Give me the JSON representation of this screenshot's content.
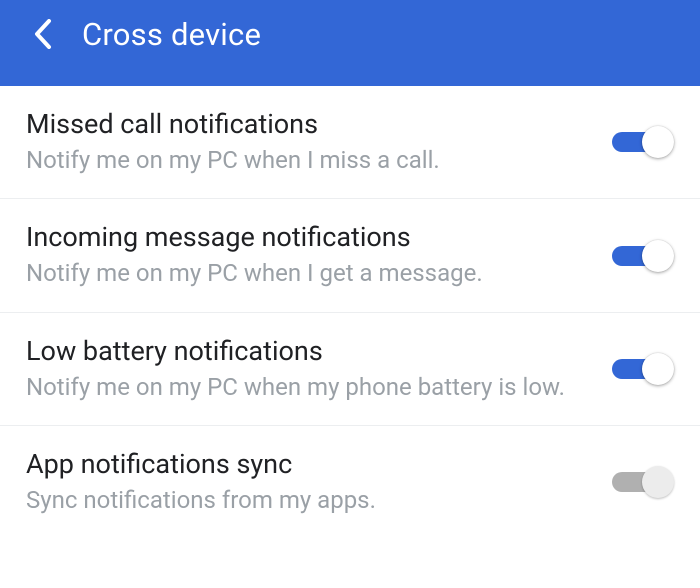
{
  "header": {
    "title": "Cross device"
  },
  "settings": [
    {
      "id": "missed-call",
      "title": "Missed call notifications",
      "subtitle": "Notify me on my PC when I miss a call.",
      "enabled": true
    },
    {
      "id": "incoming-message",
      "title": "Incoming message notifications",
      "subtitle": "Notify me on my PC when I get a message.",
      "enabled": true
    },
    {
      "id": "low-battery",
      "title": "Low battery notifications",
      "subtitle": "Notify me on my PC when my phone battery is low.",
      "enabled": true
    },
    {
      "id": "app-sync",
      "title": "App notifications sync",
      "subtitle": "Sync notifications from my apps.",
      "enabled": false
    }
  ]
}
